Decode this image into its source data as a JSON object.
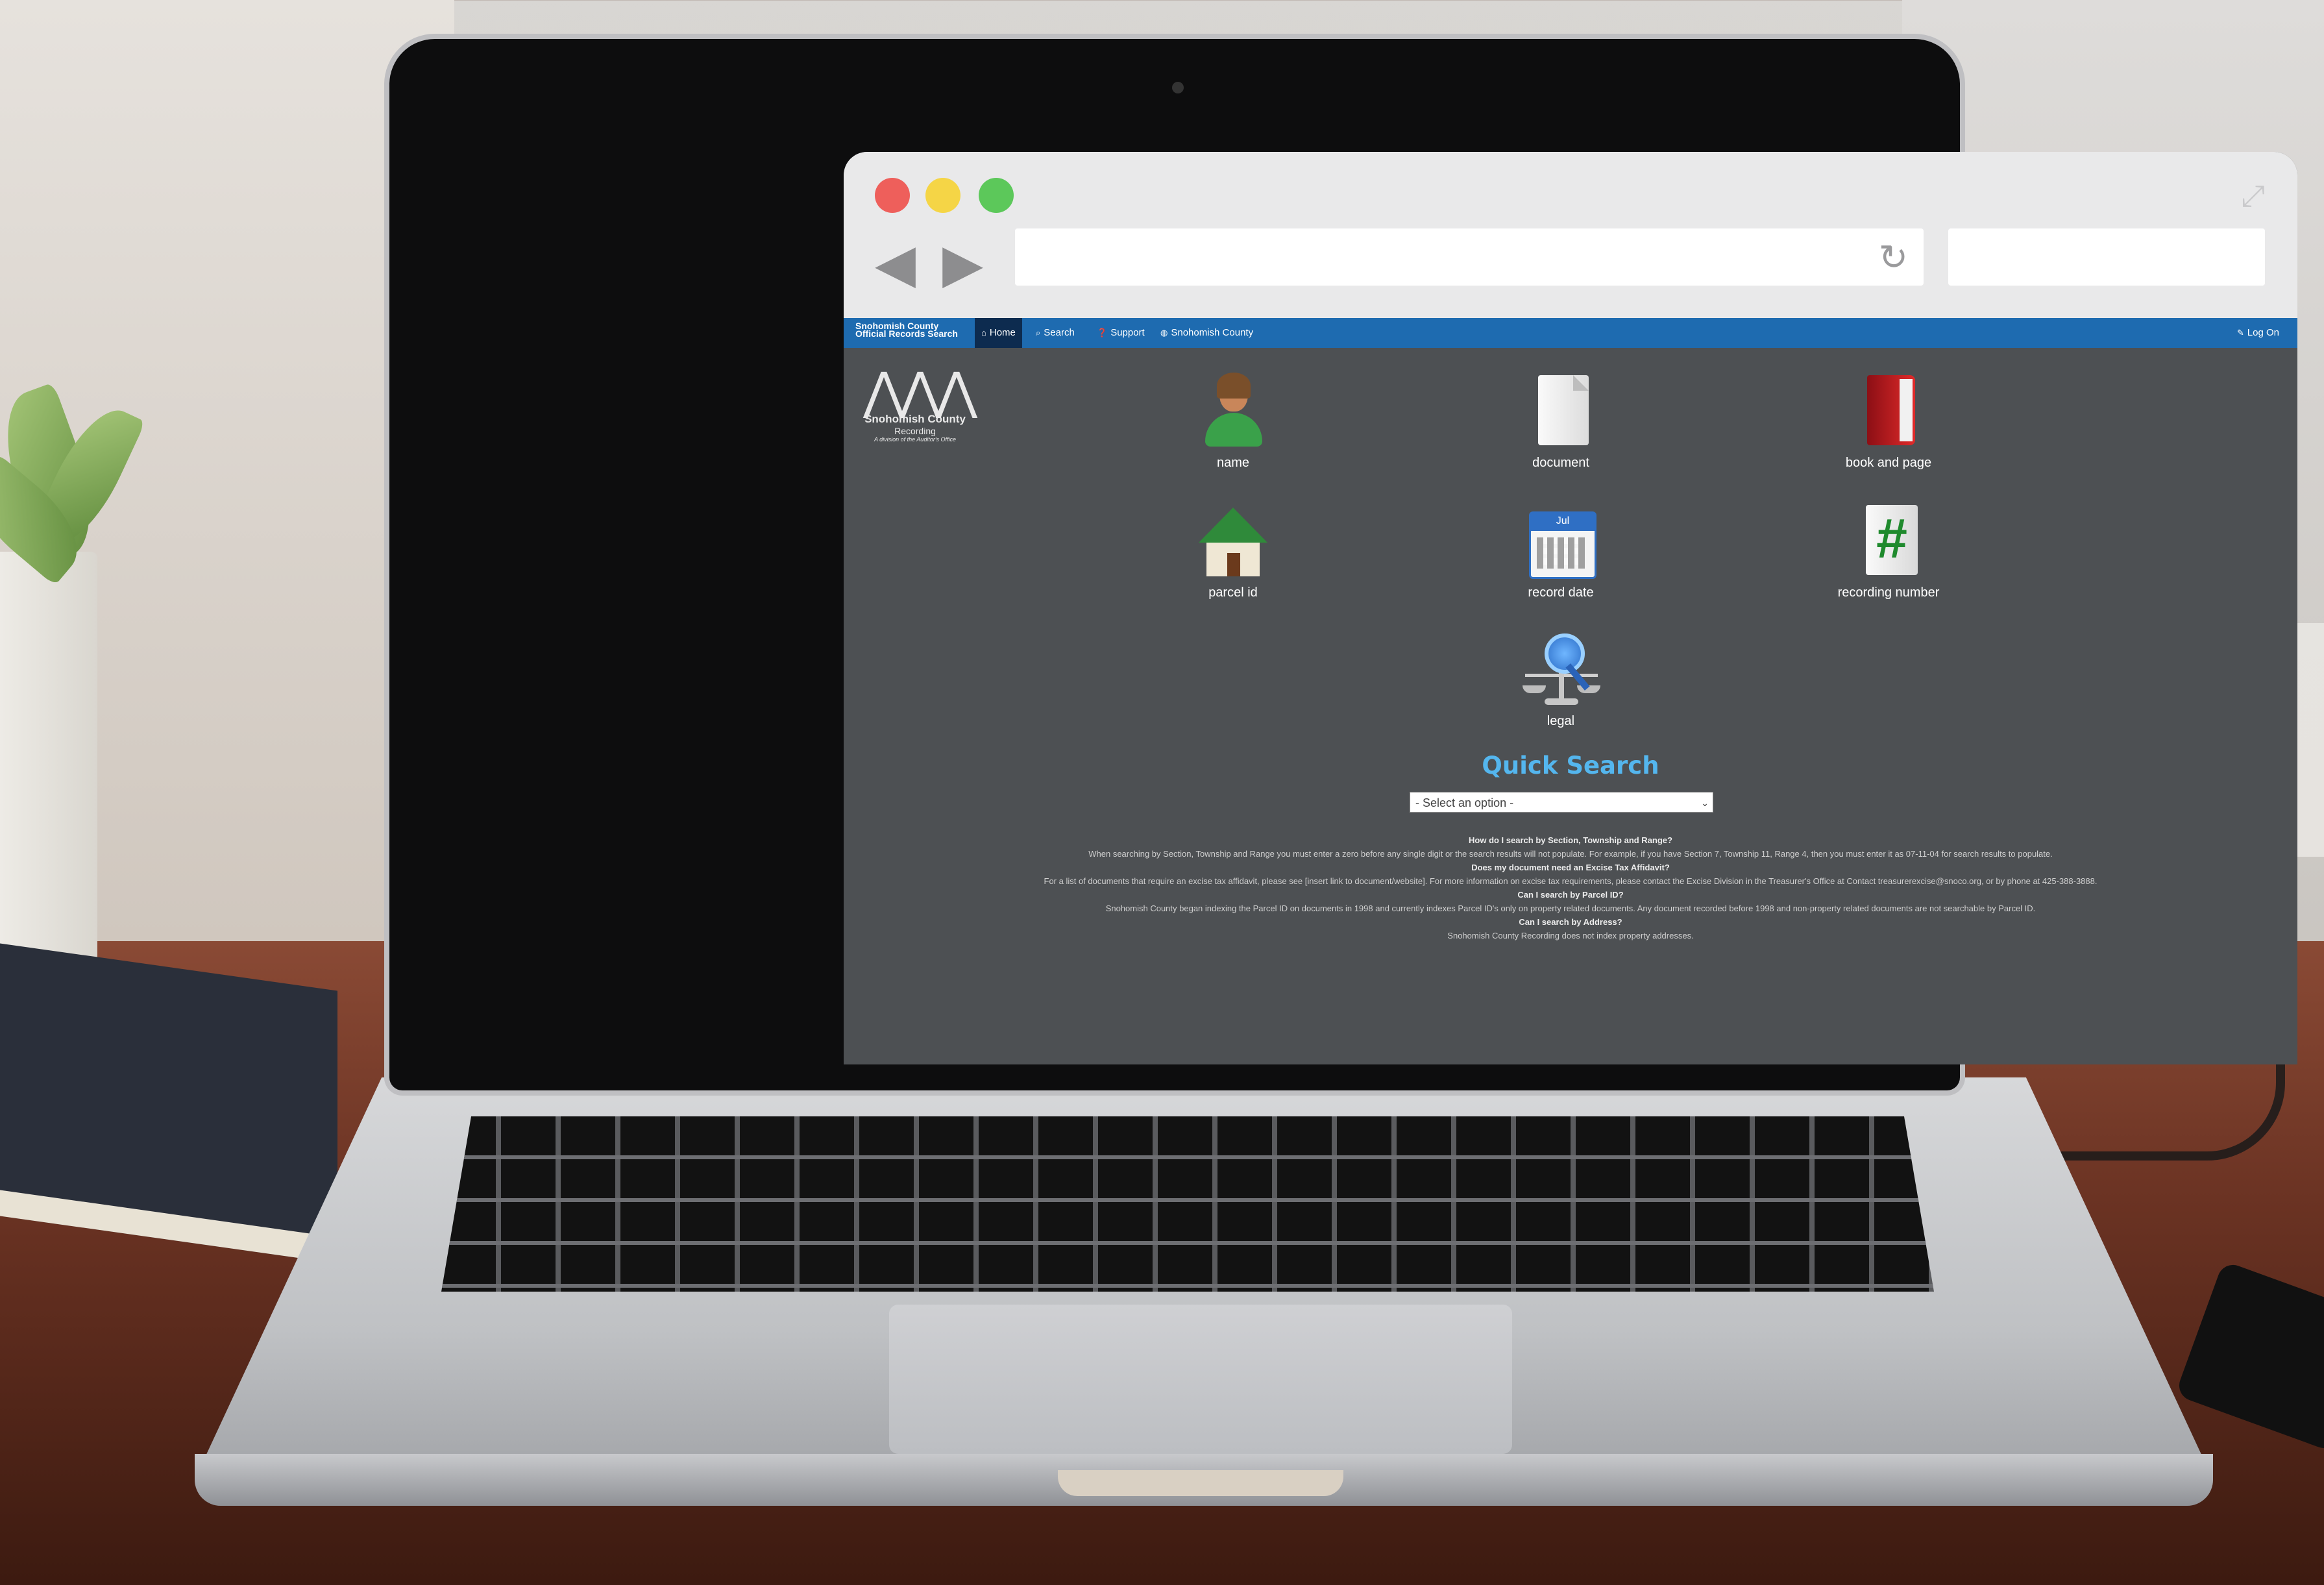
{
  "browser": {
    "url": "",
    "search": ""
  },
  "navbar": {
    "brand_line1": "Snohomish County",
    "brand_line2": "Official Records Search",
    "items": [
      {
        "label": "Home",
        "icon": "home-icon"
      },
      {
        "label": "Search",
        "icon": "search-icon"
      },
      {
        "label": "Support",
        "icon": "help-icon"
      },
      {
        "label": "Snohomish County",
        "icon": "globe-icon"
      }
    ],
    "logon": "Log On"
  },
  "logo": {
    "name": "Snohomish County",
    "sub": "Recording",
    "tag": "A division of the Auditor's Office"
  },
  "tiles": [
    {
      "label": "name",
      "icon": "person-icon"
    },
    {
      "label": "document",
      "icon": "document-icon"
    },
    {
      "label": "book and page",
      "icon": "book-icon"
    },
    {
      "label": "parcel id",
      "icon": "house-icon"
    },
    {
      "label": "record date",
      "icon": "calendar-icon"
    },
    {
      "label": "recording number",
      "icon": "hash-icon"
    },
    {
      "label": "legal",
      "icon": "legal-scale-icon"
    }
  ],
  "calendar_month": "Jul",
  "quick_search": {
    "title": "Quick Search",
    "selected": "- Select an option -"
  },
  "faq": [
    {
      "q": "How do I search by Section, Township and Range?",
      "a": "When searching by Section, Township and Range you must enter a zero before any single digit or the search results will not populate. For example, if you have Section 7, Township 11, Range 4, then you must enter it as 07-11-04 for search results to populate."
    },
    {
      "q": "Does my document need an Excise Tax Affidavit?",
      "a": "For a list of documents that require an excise tax affidavit, please see [insert link to document/website]. For more information on excise tax requirements, please contact the Excise Division in the Treasurer's Office at Contact treasurerexcise@snoco.org, or by phone at 425-388-3888."
    },
    {
      "q": "Can I search by Parcel ID?",
      "a": "Snohomish County began indexing the Parcel ID on documents in 1998 and currently indexes Parcel ID's only on property related documents. Any document recorded before 1998 and non-property related documents are not searchable by Parcel ID."
    },
    {
      "q": "Can I search by Address?",
      "a": "Snohomish County Recording does not index property addresses."
    }
  ],
  "colors": {
    "navbar": "#1e6bb0",
    "nav_active": "#0d2b4f",
    "page_bg": "#4d5053",
    "quick_title": "#54b6ee"
  }
}
